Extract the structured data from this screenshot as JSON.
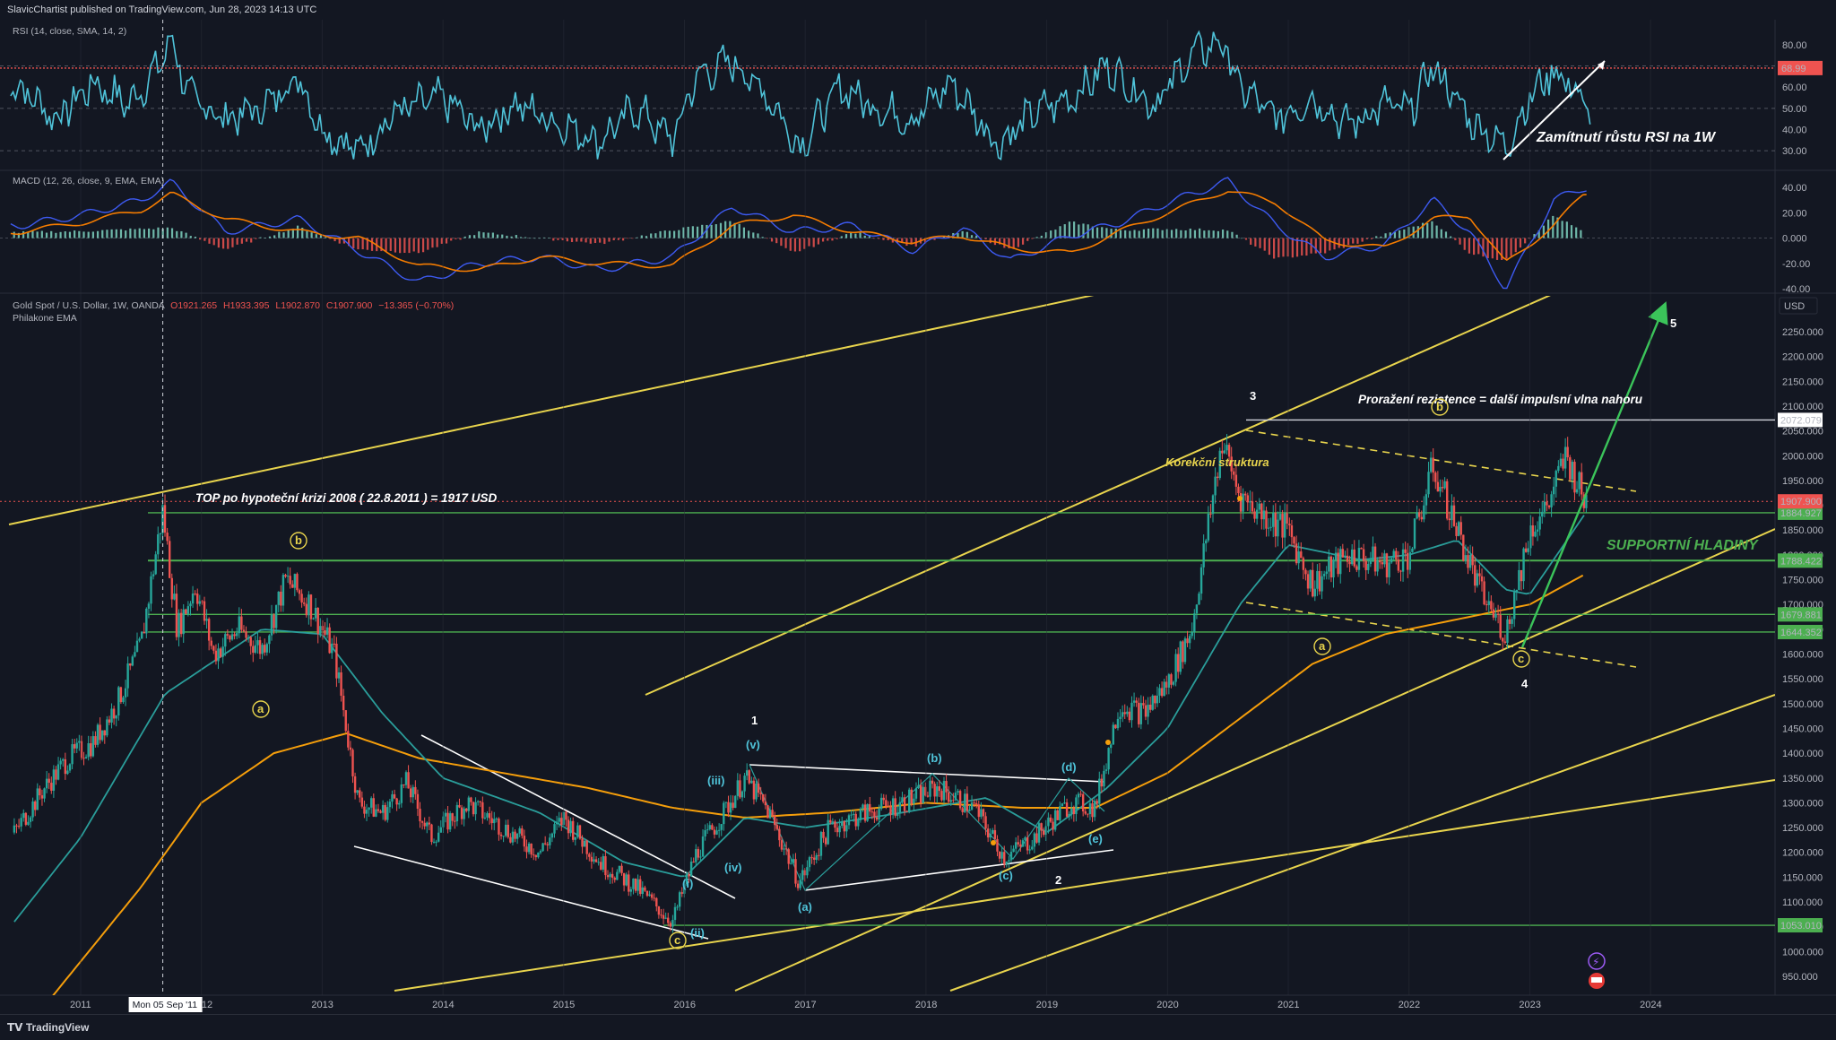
{
  "header": {
    "publisher": "SlavicChartist published on TradingView.com, Jun 28, 2023 14:13 UTC"
  },
  "footer": {
    "brand": "TradingView"
  },
  "colors": {
    "bg": "#131722",
    "grid": "#2a2e39",
    "rsi": "#4fc3d9",
    "macd": "#3d5af1",
    "signal": "#f57c00",
    "bull": "#26a69a",
    "bear": "#ef5350",
    "ema_fast": "#2a9d9a",
    "ema_slow": "#f59e0b",
    "trend": "#e8d44d",
    "support": "#4caf50",
    "arrow": "#3bc45a",
    "resist": "#d1d4dc"
  },
  "chart_data": [
    {
      "type": "line",
      "title": "RSI (14, close, SMA, 14, 2)",
      "ylim": [
        25,
        85
      ],
      "y_ticks": [
        "80.00",
        "70.00",
        "60.00",
        "50.00",
        "40.00",
        "30.00"
      ],
      "level_label": "68.99",
      "annotation": "Zamítnutí růstu RSI na 1W",
      "x": [
        2010.5,
        2010.8,
        2011.1,
        2011.4,
        2011.65,
        2011.75,
        2011.9,
        2012.2,
        2012.5,
        2012.8,
        2013.0,
        2013.3,
        2013.6,
        2014.0,
        2014.3,
        2014.6,
        2015.0,
        2015.3,
        2015.6,
        2015.9,
        2016.1,
        2016.4,
        2016.7,
        2016.95,
        2017.3,
        2017.6,
        2017.9,
        2018.2,
        2018.6,
        2018.9,
        2019.2,
        2019.5,
        2019.7,
        2019.9,
        2020.2,
        2020.45,
        2020.6,
        2020.9,
        2021.2,
        2021.5,
        2021.8,
        2022.0,
        2022.2,
        2022.5,
        2022.8,
        2023.0,
        2023.2,
        2023.35,
        2023.5
      ],
      "values": [
        60,
        45,
        62,
        52,
        70,
        83,
        55,
        45,
        50,
        65,
        40,
        30,
        48,
        55,
        40,
        52,
        42,
        35,
        50,
        35,
        65,
        72,
        55,
        32,
        60,
        50,
        45,
        62,
        33,
        48,
        55,
        70,
        60,
        52,
        75,
        82,
        60,
        45,
        55,
        42,
        52,
        48,
        70,
        45,
        32,
        55,
        68,
        60,
        48
      ]
    },
    {
      "type": "bar",
      "title": "MACD (12, 26, close, 9, EMA, EMA)",
      "ylim": [
        -40,
        50
      ],
      "y_ticks": [
        "40.00",
        "20.00",
        "0.000",
        "-20.00",
        "-40.00"
      ],
      "x": [
        2010.5,
        2011.0,
        2011.5,
        2011.75,
        2012.2,
        2012.8,
        2013.3,
        2013.8,
        2014.3,
        2014.8,
        2015.3,
        2015.9,
        2016.4,
        2016.9,
        2017.4,
        2017.9,
        2018.3,
        2018.7,
        2019.2,
        2019.6,
        2020.0,
        2020.5,
        2020.9,
        2021.3,
        2021.8,
        2022.2,
        2022.5,
        2022.8,
        2023.2,
        2023.45
      ],
      "macd": [
        10,
        18,
        30,
        44,
        5,
        15,
        -10,
        -35,
        -20,
        -15,
        -25,
        -15,
        25,
        5,
        10,
        -10,
        8,
        -18,
        2,
        12,
        28,
        45,
        10,
        -15,
        -5,
        30,
        5,
        -40,
        30,
        40
      ],
      "signal": [
        5,
        12,
        22,
        35,
        15,
        5,
        0,
        -22,
        -25,
        -15,
        -20,
        -22,
        10,
        18,
        5,
        -3,
        2,
        -8,
        -12,
        5,
        20,
        38,
        28,
        -2,
        -8,
        15,
        18,
        -20,
        10,
        35
      ]
    },
    {
      "type": "candlestick",
      "title": "Gold Spot / U.S. Dollar, 1W, OANDA",
      "ohlc_label": {
        "o": "O1921.265",
        "h": "H1933.395",
        "l": "L1902.870",
        "c": "C1907.900",
        "chg": "−13.365 (−0.70%)"
      },
      "ema_label": "Philakone EMA",
      "unit": "USD",
      "ylim": [
        900,
        2320
      ],
      "y_ticks": [
        2250,
        2200,
        2150,
        2100,
        2050,
        2000,
        1950,
        1900,
        1850,
        1800,
        1750,
        1700,
        1650,
        1600,
        1550,
        1500,
        1450,
        1400,
        1350,
        1300,
        1250,
        1200,
        1150,
        1100,
        1050,
        1000,
        950
      ],
      "y_tick_labels": [
        "2250.000",
        "2200.000",
        "2150.000",
        "2100.000",
        "2050.000",
        "2000.000",
        "1950.000",
        "1900.000",
        "1850.000",
        "1800.000",
        "1750.000",
        "1700.000",
        "1650.000",
        "1600.000",
        "1550.000",
        "1500.000",
        "1450.000",
        "1400.000",
        "1350.000",
        "1300.000",
        "1250.000",
        "1200.000",
        "1150.000",
        "1100.000",
        "1050.000",
        "1000.000",
        "950.000"
      ],
      "x_ticks": [
        2011,
        2012,
        2013,
        2014,
        2015,
        2016,
        2017,
        2018,
        2019,
        2020,
        2021,
        2022,
        2023,
        2024
      ],
      "x_tick_labels": [
        "2011",
        "2012",
        "2013",
        "2014",
        "2015",
        "2016",
        "2017",
        "2018",
        "2019",
        "2020",
        "2021",
        "2022",
        "2023",
        "2024"
      ],
      "xlim": [
        2010.4,
        2025.3
      ],
      "crosshair": {
        "x": 2011.68,
        "label": "Mon 05 Sep '11"
      },
      "price_path": {
        "x": [
          2010.45,
          2010.7,
          2010.9,
          2011.1,
          2011.3,
          2011.5,
          2011.68,
          2011.8,
          2011.95,
          2012.1,
          2012.3,
          2012.5,
          2012.7,
          2012.9,
          2013.1,
          2013.3,
          2013.5,
          2013.7,
          2013.9,
          2014.2,
          2014.5,
          2014.8,
          2015.0,
          2015.3,
          2015.6,
          2015.9,
          2016.1,
          2016.3,
          2016.5,
          2016.7,
          2016.95,
          2017.2,
          2017.5,
          2017.8,
          2018.1,
          2018.4,
          2018.65,
          2018.9,
          2019.2,
          2019.4,
          2019.6,
          2019.8,
          2020.0,
          2020.2,
          2020.45,
          2020.6,
          2020.8,
          2021.0,
          2021.2,
          2021.5,
          2021.8,
          2022.0,
          2022.2,
          2022.4,
          2022.6,
          2022.8,
          2023.0,
          2023.15,
          2023.3,
          2023.45
        ],
        "y": [
          1240,
          1330,
          1390,
          1420,
          1500,
          1620,
          1890,
          1650,
          1740,
          1600,
          1650,
          1610,
          1750,
          1700,
          1600,
          1300,
          1280,
          1340,
          1230,
          1300,
          1250,
          1200,
          1270,
          1180,
          1130,
          1060,
          1200,
          1270,
          1350,
          1280,
          1140,
          1250,
          1280,
          1300,
          1330,
          1290,
          1190,
          1230,
          1300,
          1290,
          1500,
          1480,
          1540,
          1650,
          2030,
          1920,
          1880,
          1850,
          1740,
          1800,
          1780,
          1800,
          1980,
          1850,
          1720,
          1640,
          1850,
          1900,
          2000,
          1910
        ]
      },
      "ema_fast": {
        "x": [
          2010.45,
          2011.0,
          2011.7,
          2012.5,
          2013.0,
          2013.5,
          2014.0,
          2014.8,
          2015.5,
          2016.0,
          2016.5,
          2017.0,
          2017.8,
          2018.5,
          2019.0,
          2019.5,
          2020.0,
          2020.6,
          2021.0,
          2021.6,
          2022.0,
          2022.4,
          2022.8,
          2023.0,
          2023.45
        ],
        "y": [
          1060,
          1230,
          1520,
          1650,
          1640,
          1480,
          1350,
          1280,
          1180,
          1150,
          1270,
          1250,
          1280,
          1310,
          1240,
          1330,
          1450,
          1700,
          1820,
          1790,
          1800,
          1830,
          1730,
          1720,
          1880
        ]
      },
      "ema_slow": {
        "x": [
          2010.6,
          2011.0,
          2011.5,
          2012.0,
          2012.6,
          2013.2,
          2013.8,
          2014.5,
          2015.2,
          2015.9,
          2016.5,
          2017.2,
          2018.0,
          2018.8,
          2019.4,
          2020.0,
          2020.6,
          2021.2,
          2021.8,
          2022.4,
          2023.0,
          2023.45
        ],
        "y": [
          860,
          980,
          1130,
          1300,
          1400,
          1440,
          1390,
          1360,
          1330,
          1290,
          1270,
          1280,
          1300,
          1290,
          1290,
          1360,
          1470,
          1580,
          1640,
          1670,
          1700,
          1760
        ]
      },
      "horizontal_levels": [
        {
          "value": 2072.079,
          "label": "2072.079",
          "kind": "resistance"
        },
        {
          "value": 1884.927,
          "label": "1884.927",
          "kind": "support"
        },
        {
          "value": 1788.422,
          "label": "1788.422",
          "kind": "support"
        },
        {
          "value": 1679.881,
          "label": "1679.881",
          "kind": "support"
        },
        {
          "value": 1644.352,
          "label": "1644.352",
          "kind": "support"
        },
        {
          "value": 1053.01,
          "label": "1053.010",
          "kind": "support"
        }
      ],
      "last_price": {
        "value": 1907.9,
        "label": "1907.900"
      },
      "annotations": {
        "top": "TOP po hypoteční krizi 2008 ( 22.8.2011 ) = 1917 USD",
        "correction": "Korekční struktura",
        "breakout": "Proražení rezistence = další impulsní vlna nahoru",
        "support": "SUPPORTNÍ HLADINY"
      },
      "wave_labels": {
        "w1": "1",
        "w2": "2",
        "w3": "3",
        "w4": "4",
        "w5": "5",
        "a": "a",
        "b": "b",
        "c": "c",
        "iii": "(iii)",
        "v": "(v)",
        "i": "(i)",
        "iv": "(iv)",
        "ii": "(ii)",
        "pa": "(a)",
        "pb": "(b)",
        "pc": "(c)",
        "pd": "(d)",
        "pe": "(e)"
      }
    }
  ]
}
